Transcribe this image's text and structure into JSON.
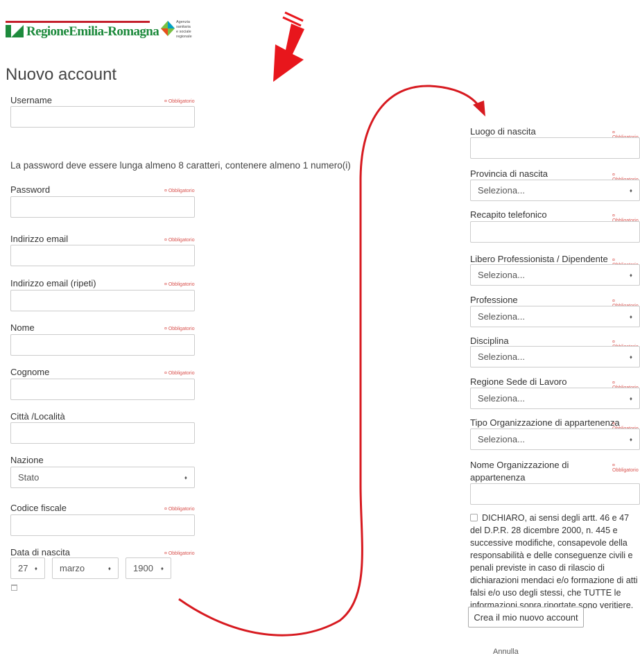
{
  "header": {
    "logo_text": "RegioneEmilia-Romagna",
    "agency_text": "Agenzia\nsanitaria\ne sociale\nregionale"
  },
  "page_title": "Nuovo account",
  "required_label": "Obbligatorio",
  "password_note": "La password deve essere lunga almeno 8 caratteri, contenere almeno 1 numero(i)",
  "left_fields": {
    "username": "Username",
    "password": "Password",
    "email": "Indirizzo email",
    "email_repeat": "Indirizzo email (ripeti)",
    "nome": "Nome",
    "cognome": "Cognome",
    "citta": "Città /Località",
    "nazione": "Nazione",
    "nazione_value": "Stato",
    "codice_fiscale": "Codice fiscale",
    "data_nascita": "Data di nascita",
    "day_value": "27",
    "month_value": "marzo",
    "year_value": "1900"
  },
  "right_fields": {
    "luogo": "Luogo di nascita",
    "provincia": "Provincia di nascita",
    "recapito": "Recapito telefonico",
    "libero": "Libero Professionista / Dipendente",
    "professione": "Professione",
    "disciplina": "Disciplina",
    "regione": "Regione Sede di Lavoro",
    "tipo_org": "Tipo Organizzazione di appartenenza",
    "nome_org": "Nome Organizzazione di appartenenza",
    "select_placeholder": "Seleziona..."
  },
  "declaration": "DICHIARO, ai sensi degli artt. 46 e 47 del D.P.R. 28 dicembre 2000, n. 445 e successive modifiche, consapevole della responsabilità e delle conseguenze civili e penali previste in caso di rilascio di dichiarazioni mendaci e/o formazione di atti falsi e/o uso degli stessi, che TUTTE le informazioni sopra riportate sono veritiere.",
  "buttons": {
    "create": "Crea il mio nuovo account",
    "cancel": "Annulla"
  },
  "colors": {
    "annotation": "#e8161c",
    "brand_green": "#1d8a3c",
    "brand_red": "#c41f2c"
  }
}
